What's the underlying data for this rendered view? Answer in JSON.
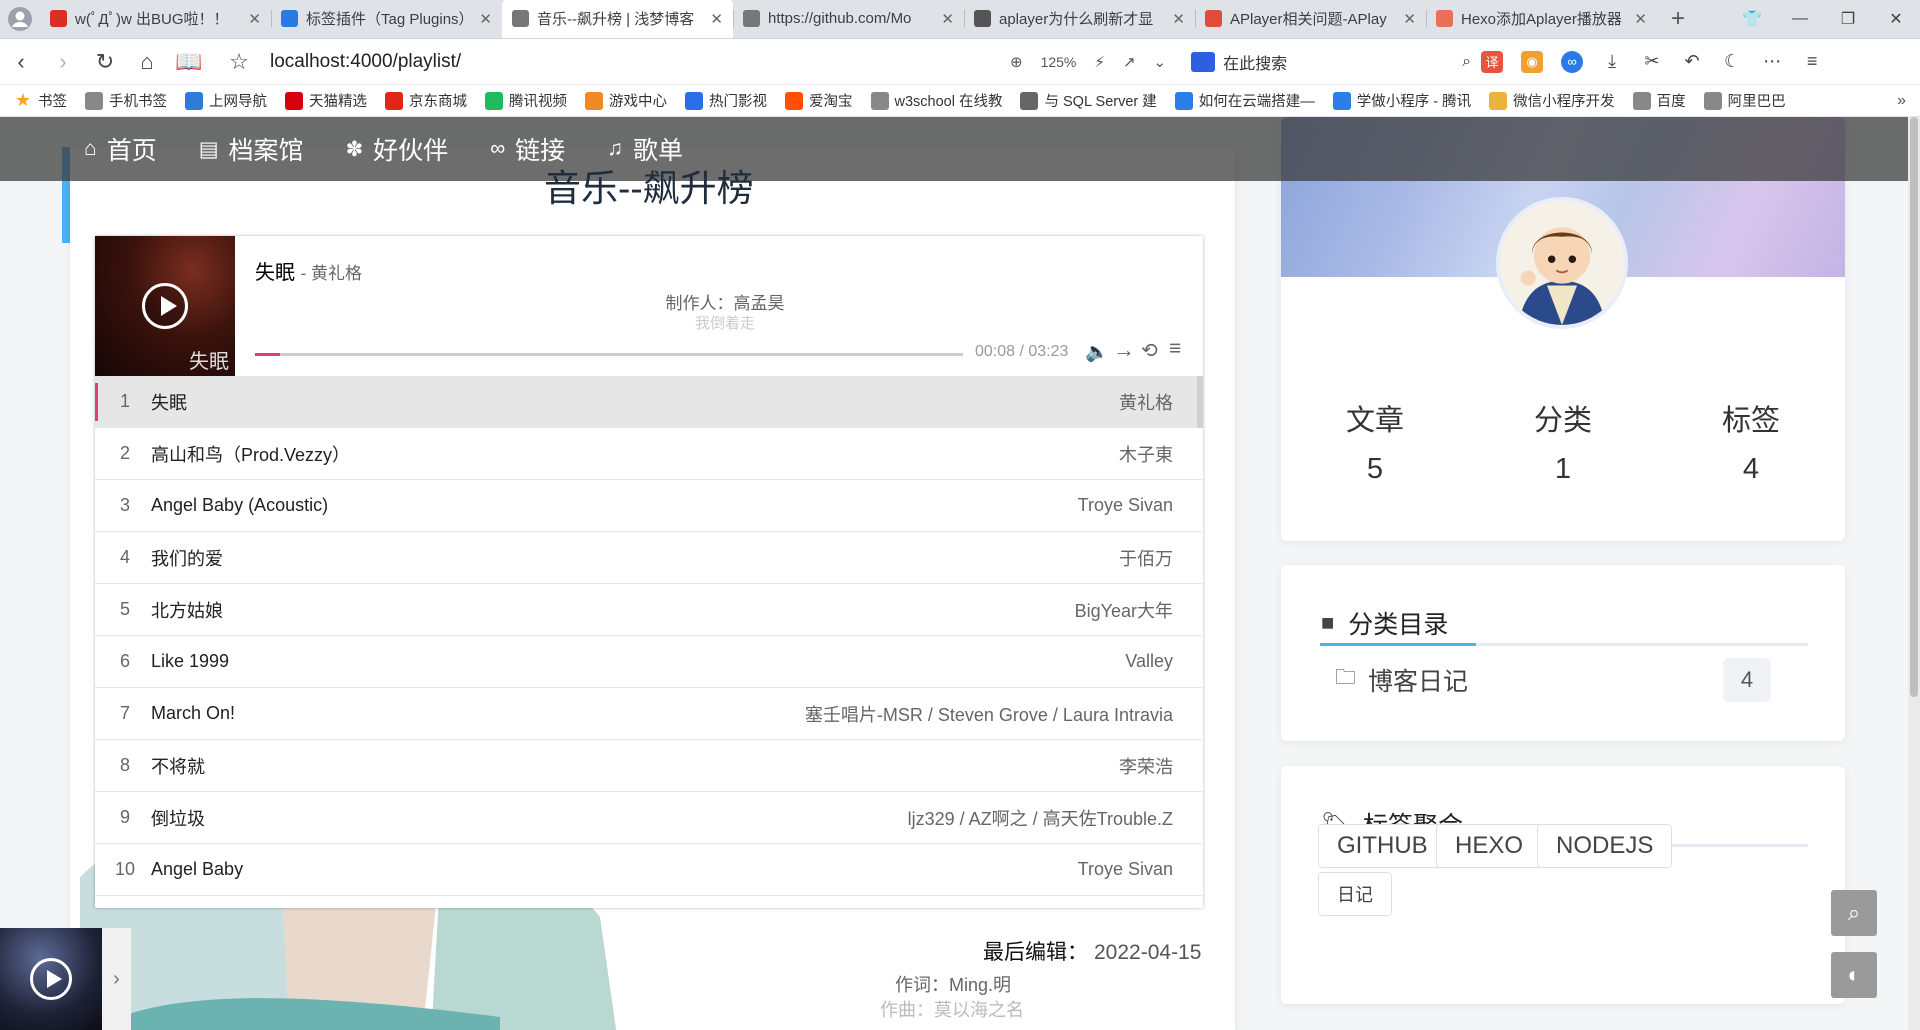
{
  "browser": {
    "tabs": [
      {
        "title": "w(ﾟДﾟ)w 出BUG啦！！",
        "icon": "warning-icon",
        "color": "#d93025",
        "active": false
      },
      {
        "title": "标签插件（Tag Plugins）",
        "icon": "hexo-icon",
        "color": "#2a7ae2",
        "active": false
      },
      {
        "title": "音乐--飙升榜 | 浅梦博客",
        "icon": "globe-icon",
        "color": "#777777",
        "active": true
      },
      {
        "title": "https://github.com/Mo",
        "icon": "globe-icon",
        "color": "#777777",
        "active": false
      },
      {
        "title": "aplayer为什么刷新才显",
        "icon": "sogou-icon",
        "color": "#555555",
        "active": false
      },
      {
        "title": "APlayer相关问题-APlay",
        "icon": "shield-icon",
        "color": "#e04b3a",
        "active": false
      },
      {
        "title": "Hexo添加Aplayer播放器",
        "icon": "jianshu-icon",
        "color": "#ea6f5a",
        "active": false
      }
    ],
    "new_tab": "+",
    "url": "localhost:4000/playlist/",
    "zoom": "125%",
    "search_placeholder": "在此搜索",
    "bookmarks": [
      {
        "label": "书签",
        "icon": "star-icon",
        "color": "#f5a623"
      },
      {
        "label": "手机书签",
        "icon": "phone-icon",
        "color": "#888888"
      },
      {
        "label": "上网导航",
        "icon": "ie-icon",
        "color": "#2f7bd8"
      },
      {
        "label": "天猫精选",
        "icon": "tmall-icon",
        "color": "#d6000f"
      },
      {
        "label": "京东商城",
        "icon": "jd-icon",
        "color": "#e1251b"
      },
      {
        "label": "腾讯视频",
        "icon": "video-icon",
        "color": "#1ebc5c"
      },
      {
        "label": "游戏中心",
        "icon": "game-icon",
        "color": "#f08a24"
      },
      {
        "label": "热门影视",
        "icon": "play-icon",
        "color": "#2a6fe8"
      },
      {
        "label": "爱淘宝",
        "icon": "taobao-icon",
        "color": "#ff5000"
      },
      {
        "label": "w3school 在线教",
        "icon": "globe-icon",
        "color": "#888888"
      },
      {
        "label": "与 SQL Server 建",
        "icon": "link-icon",
        "color": "#666666"
      },
      {
        "label": "如何在云端搭建—",
        "icon": "cloud-icon",
        "color": "#2b7de9"
      },
      {
        "label": "学做小程序 - 腾讯",
        "icon": "cloud-icon",
        "color": "#2b7de9"
      },
      {
        "label": "微信小程序开发",
        "icon": "folder-icon",
        "color": "#e8b53a"
      },
      {
        "label": "百度",
        "icon": "globe-icon",
        "color": "#888888"
      },
      {
        "label": "阿里巴巴",
        "icon": "globe-icon",
        "color": "#888888"
      }
    ],
    "bookmarks_more": "»"
  },
  "site": {
    "nav": [
      {
        "label": "首页",
        "icon": "home-icon"
      },
      {
        "label": "档案馆",
        "icon": "file-icon"
      },
      {
        "label": "好伙伴",
        "icon": "paw-icon"
      },
      {
        "label": "链接",
        "icon": "link-icon"
      },
      {
        "label": "歌单",
        "icon": "music-icon"
      }
    ],
    "post_title": "音乐--飙升榜",
    "accent": "#49b1f5"
  },
  "player": {
    "cover_text": "失眠",
    "current_title": "失眠",
    "current_artist": "黄礼格",
    "lrc_current": "制作人：高孟昊",
    "lrc_next": "我倒着走",
    "time": "00:08 / 03:23",
    "progress_fraction": 0.035,
    "played_color": "#e03f70",
    "list": [
      {
        "index": "1",
        "title": "失眠",
        "author": "黄礼格"
      },
      {
        "index": "2",
        "title": "高山和鸟（Prod.Vezzy）",
        "author": "木子東"
      },
      {
        "index": "3",
        "title": "Angel Baby (Acoustic)",
        "author": "Troye Sivan"
      },
      {
        "index": "4",
        "title": "我们的爱",
        "author": "于佰万"
      },
      {
        "index": "5",
        "title": "北方姑娘",
        "author": "BigYear大年"
      },
      {
        "index": "6",
        "title": "Like 1999",
        "author": "Valley"
      },
      {
        "index": "7",
        "title": "March On!",
        "author": "塞壬唱片-MSR / Steven Grove / Laura Intravia"
      },
      {
        "index": "8",
        "title": "不将就",
        "author": "李荣浩"
      },
      {
        "index": "9",
        "title": "倒垃圾",
        "author": "ljz329 / AZ啊之 / 高天佐Trouble.Z"
      },
      {
        "index": "10",
        "title": "Angel Baby",
        "author": "Troye Sivan"
      }
    ]
  },
  "post_footer": {
    "last_edit_label": "最后编辑：",
    "last_edit_date": "2022-04-15",
    "lrc_a": "作词：Ming.明",
    "lrc_b": "作曲：莫以海之名"
  },
  "sidebar": {
    "stats": [
      {
        "label": "文章",
        "value": "5"
      },
      {
        "label": "分类",
        "value": "1"
      },
      {
        "label": "标签",
        "value": "4"
      }
    ],
    "categories_title": "分类目录",
    "categories": [
      {
        "name": "博客日记",
        "count": "4"
      }
    ],
    "tags_title": "标签聚合",
    "tags": [
      "GITHUB",
      "HEXO",
      "NODEJS",
      "日记"
    ]
  }
}
